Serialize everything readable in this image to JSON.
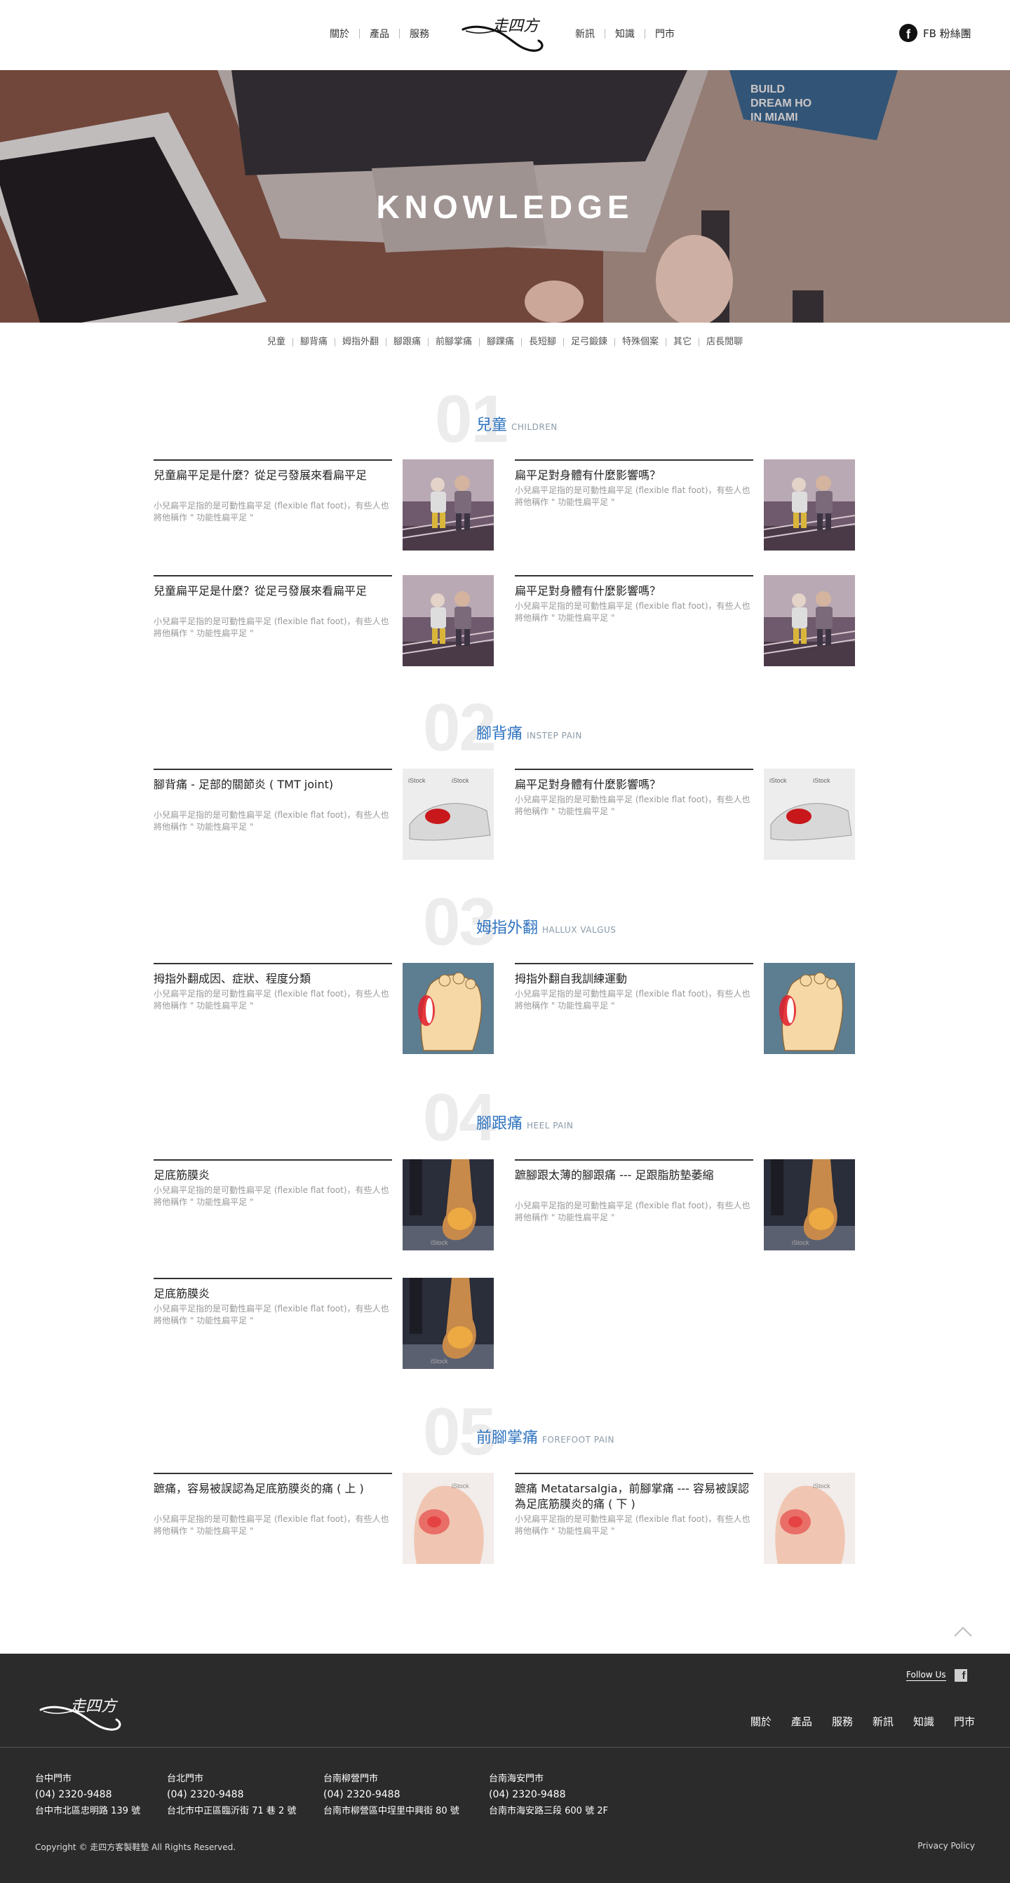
{
  "header": {
    "nav_left": [
      "關於",
      "產品",
      "服務"
    ],
    "nav_right": [
      "新訊",
      "知識",
      "門市"
    ],
    "fb_label": "FB 粉絲團"
  },
  "hero": {
    "title": "KNOWLEDGE",
    "image_text": [
      "BUILD",
      "DREAM HO",
      "IN MIAMI"
    ]
  },
  "categories": [
    "兒童",
    "腳背痛",
    "姆指外翻",
    "腳跟痛",
    "前腳掌痛",
    "腳踝痛",
    "長短腳",
    "足弓鍛鍊",
    "特殊個案",
    "其它",
    "店長閒聊"
  ],
  "sections": [
    {
      "num": "01",
      "title": "兒童",
      "en": "CHILDREN",
      "cards": [
        {
          "title": "兒童扁平足是什麼？從足弓發展來看扁平足",
          "desc": "小兒扁平足指的是可動性扁平足 (flexible flat foot)，有些人也將他稱作 \" 功能性扁平足 \""
        },
        {
          "title": "扁平足對身體有什麼影響嗎？",
          "desc": "小兒扁平足指的是可動性扁平足 (flexible flat foot)，有些人也將他稱作 \" 功能性扁平足 \""
        },
        {
          "title": "兒童扁平足是什麼？從足弓發展來看扁平足",
          "desc": "小兒扁平足指的是可動性扁平足 (flexible flat foot)，有些人也將他稱作 \" 功能性扁平足 \""
        },
        {
          "title": "扁平足對身體有什麼影響嗎？",
          "desc": "小兒扁平足指的是可動性扁平足 (flexible flat foot)，有些人也將他稱作 \" 功能性扁平足 \""
        }
      ]
    },
    {
      "num": "02",
      "title": "腳背痛",
      "en": "INSTEP PAIN",
      "cards": [
        {
          "title": "腳背痛 - 足部的關節炎 ( TMT joint)",
          "desc": "小兒扁平足指的是可動性扁平足 (flexible flat foot)，有些人也將他稱作 \" 功能性扁平足 \""
        },
        {
          "title": "扁平足對身體有什麼影響嗎？",
          "desc": "小兒扁平足指的是可動性扁平足 (flexible flat foot)，有些人也將他稱作 \" 功能性扁平足 \""
        }
      ]
    },
    {
      "num": "03",
      "title": "姆指外翻",
      "en": "HALLUX VALGUS",
      "cards": [
        {
          "title": "拇指外翻成因、症狀、程度分類",
          "desc": "小兒扁平足指的是可動性扁平足 (flexible flat foot)，有些人也將他稱作 \" 功能性扁平足 \""
        },
        {
          "title": "拇指外翻自我訓練運動",
          "desc": "小兒扁平足指的是可動性扁平足 (flexible flat foot)，有些人也將他稱作 \" 功能性扁平足 \""
        }
      ]
    },
    {
      "num": "04",
      "title": "腳跟痛",
      "en": "HEEL PAIN",
      "cards": [
        {
          "title": "足底筋膜炎",
          "desc": "小兒扁平足指的是可動性扁平足 (flexible flat foot)，有些人也將他稱作 \" 功能性扁平足 \""
        },
        {
          "title": "蹠腳跟太薄的腳跟痛 --- 足跟脂肪墊萎縮",
          "desc": "小兒扁平足指的是可動性扁平足 (flexible flat foot)，有些人也將他稱作 \" 功能性扁平足 \""
        },
        {
          "title": "足底筋膜炎",
          "desc": "小兒扁平足指的是可動性扁平足 (flexible flat foot)，有些人也將他稱作 \" 功能性扁平足 \""
        }
      ]
    },
    {
      "num": "05",
      "title": "前腳掌痛",
      "en": "FOREFOOT PAIN",
      "cards": [
        {
          "title": "蹠痛，容易被誤認為足底筋膜炎的痛 ( 上 )",
          "desc": "小兒扁平足指的是可動性扁平足 (flexible flat foot)，有些人也將他稱作 \" 功能性扁平足 \""
        },
        {
          "title": "蹠痛 Metatarsalgia，前腳掌痛 --- 容易被誤認為足底筋膜炎的痛 ( 下 )",
          "desc": "小兒扁平足指的是可動性扁平足 (flexible flat foot)，有些人也將他稱作 \" 功能性扁平足 \""
        }
      ]
    }
  ],
  "image_watermark": "iStock",
  "footer": {
    "follow_us": "Follow Us",
    "nav": [
      "關於",
      "產品",
      "服務",
      "新訊",
      "知識",
      "門市"
    ],
    "stores": [
      {
        "name": "台中門市",
        "phone": "(04) 2320-9488",
        "address": "台中市北區忠明路 139 號"
      },
      {
        "name": "台北門市",
        "phone": "(04) 2320-9488",
        "address": "台北市中正區臨沂街 71 巷 2 號"
      },
      {
        "name": "台南柳營門市",
        "phone": "(04) 2320-9488",
        "address": "台南市柳營區中埕里中興街 80 號"
      },
      {
        "name": "台南海安門市",
        "phone": "(04) 2320-9488",
        "address": "台南市海安路三段 600 號 2F"
      }
    ],
    "copyright": "Copyright © 走四方客製鞋墊 All Rights Reserved.",
    "privacy": "Privacy Policy"
  }
}
